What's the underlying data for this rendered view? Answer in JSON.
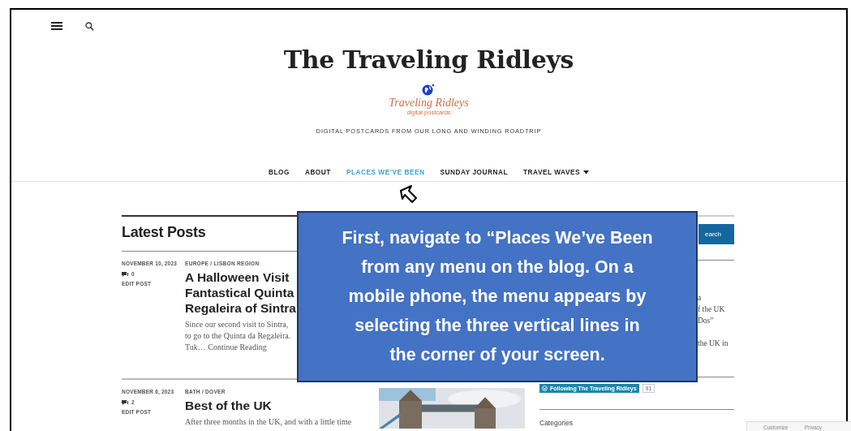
{
  "site_title": "The Traveling Ridleys",
  "logo": {
    "name": "Traveling Ridleys",
    "subtitle": "digital postcards"
  },
  "tagline": "DIGITAL POSTCARDS FROM OUR LONG AND WINDING ROADTRIP",
  "nav": [
    {
      "label": "BLOG",
      "selected": false,
      "dropdown": false
    },
    {
      "label": "ABOUT",
      "selected": false,
      "dropdown": false
    },
    {
      "label": "PLACES WE’VE BEEN",
      "selected": true,
      "dropdown": false
    },
    {
      "label": "SUNDAY JOURNAL",
      "selected": false,
      "dropdown": false
    },
    {
      "label": "TRAVEL WAVES",
      "selected": false,
      "dropdown": true
    }
  ],
  "section_title": "Latest Posts",
  "posts": [
    {
      "date": "NOVEMBER 10, 2023",
      "categories": "EUROPE / LISBON REGION",
      "comments": "0",
      "edit": "EDIT POST",
      "title_lines": [
        "A Halloween Visit",
        "Fantastical Quinta",
        "Regaleira of Sintra"
      ],
      "excerpt_lines": [
        "Since our second visit to Sintra,",
        "to go to the Quinta da Regaleira.",
        "Tuk… Continue Reading"
      ]
    },
    {
      "date": "NOVEMBER 6, 2023",
      "categories": "BATH / DOVER",
      "comments": "2",
      "edit": "EDIT POST",
      "title_lines": [
        "Best of the UK"
      ],
      "excerpt_lines": [
        "After three months in the UK, and with a little time"
      ],
      "thumbnail": true
    }
  ],
  "sidebar": {
    "search_button": "earch",
    "fragment_groups": [
      [
        "a",
        "f the UK",
        "Dos”"
      ],
      [
        "the UK in"
      ]
    ],
    "follow_button": {
      "label": "Following The Traveling Ridleys",
      "count": "91"
    },
    "categories_heading": "Categories"
  },
  "callout": {
    "lines": [
      "First, navigate to “Places We’ve Been",
      "from any menu on the blog.  On a",
      "mobile phone, the menu appears by",
      "selecting the three vertical lines in",
      "the corner of your screen."
    ]
  },
  "admin_bar": {
    "items": [
      "Customize",
      "Privacy"
    ]
  }
}
